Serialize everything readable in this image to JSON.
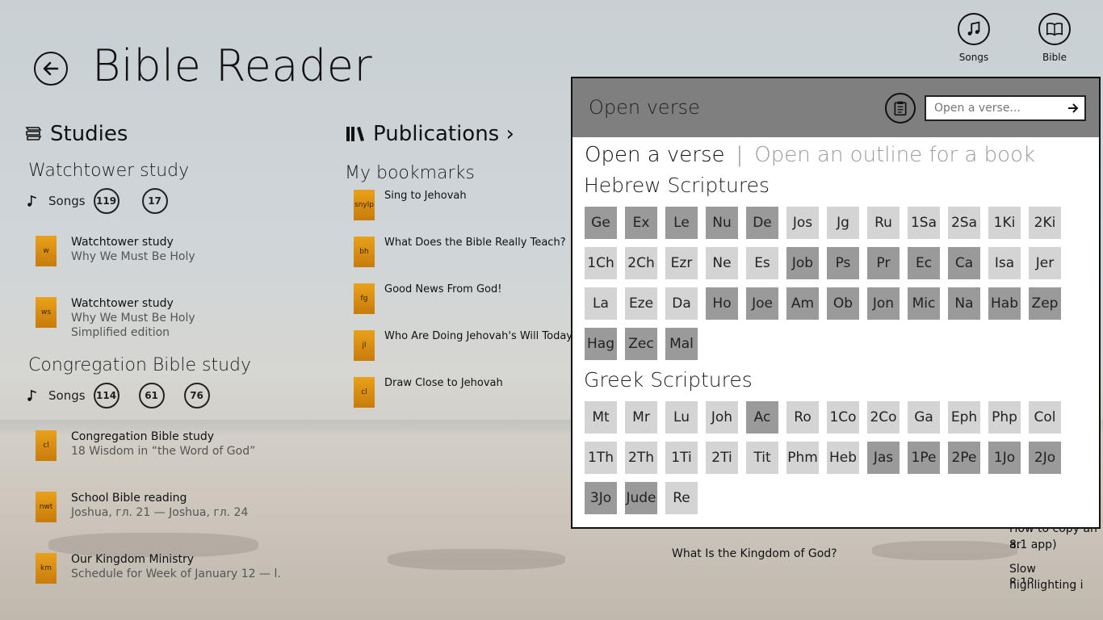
{
  "app": {
    "title": "Bible Reader"
  },
  "topbar": {
    "songs_label": "Songs",
    "bible_label": "Bible"
  },
  "studies": {
    "heading": "Studies",
    "watchtower": {
      "title": "Watchtower study",
      "songs_label": "Songs",
      "songs": [
        "119",
        "17"
      ],
      "items": [
        {
          "code": "w",
          "title": "Watchtower study",
          "subtitle": "Why We Must Be Holy",
          "extra": ""
        },
        {
          "code": "ws",
          "title": "Watchtower study",
          "subtitle": "Why We Must Be Holy",
          "extra": "Simplified edition"
        }
      ]
    },
    "congregation": {
      "title": "Congregation Bible study",
      "songs_label": "Songs",
      "songs": [
        "114",
        "61",
        "76"
      ],
      "items": [
        {
          "code": "cl",
          "title": "Congregation Bible study",
          "subtitle": "18 Wisdom in “the Word of God”"
        },
        {
          "code": "nwt",
          "title": "School Bible reading",
          "subtitle": "Joshua, гл. 21 — Joshua, гл. 24"
        },
        {
          "code": "km",
          "title": "Our Kingdom Ministry",
          "subtitle": "Schedule for Week of January 12 — l."
        }
      ]
    }
  },
  "publications": {
    "heading": "Publications ›",
    "bookmarks_title": "My bookmarks",
    "bookmarks": [
      {
        "code": "snylp",
        "title": "Sing to Jehovah"
      },
      {
        "code": "bh",
        "title": "What Does the Bible Really Teach?"
      },
      {
        "code": "fg",
        "title": "Good News From God!"
      },
      {
        "code": "jl",
        "title": "Who Are Doing Jehovah's Will Today?"
      },
      {
        "code": "cl",
        "title": "Draw Close to Jehovah"
      }
    ]
  },
  "dialog": {
    "title": "Open verse",
    "input_placeholder": "Open a verse...",
    "tab_active": "Open a verse",
    "tab_separator": "|",
    "tab_inactive": "Open an outline for a book",
    "hebrew_heading": "Hebrew Scriptures",
    "greek_heading": "Greek Scriptures",
    "hebrew_books": [
      {
        "n": "Ge",
        "s": "dark"
      },
      {
        "n": "Ex",
        "s": "dark"
      },
      {
        "n": "Le",
        "s": "dark"
      },
      {
        "n": "Nu",
        "s": "dark"
      },
      {
        "n": "De",
        "s": "dark"
      },
      {
        "n": "Jos",
        "s": "light"
      },
      {
        "n": "Jg",
        "s": "light"
      },
      {
        "n": "Ru",
        "s": "light"
      },
      {
        "n": "1Sa",
        "s": "light"
      },
      {
        "n": "2Sa",
        "s": "light"
      },
      {
        "n": "1Ki",
        "s": "light"
      },
      {
        "n": "2Ki",
        "s": "light"
      },
      {
        "n": "1Ch",
        "s": "light"
      },
      {
        "n": "2Ch",
        "s": "light"
      },
      {
        "n": "Ezr",
        "s": "light"
      },
      {
        "n": "Ne",
        "s": "light"
      },
      {
        "n": "Es",
        "s": "light"
      },
      {
        "n": "Job",
        "s": "dark"
      },
      {
        "n": "Ps",
        "s": "dark"
      },
      {
        "n": "Pr",
        "s": "dark"
      },
      {
        "n": "Ec",
        "s": "dark"
      },
      {
        "n": "Ca",
        "s": "dark"
      },
      {
        "n": "Isa",
        "s": "light"
      },
      {
        "n": "Jer",
        "s": "light"
      },
      {
        "n": "La",
        "s": "light"
      },
      {
        "n": "Eze",
        "s": "light"
      },
      {
        "n": "Da",
        "s": "light"
      },
      {
        "n": "Ho",
        "s": "dark"
      },
      {
        "n": "Joe",
        "s": "dark"
      },
      {
        "n": "Am",
        "s": "dark"
      },
      {
        "n": "Ob",
        "s": "dark"
      },
      {
        "n": "Jon",
        "s": "dark"
      },
      {
        "n": "Mic",
        "s": "dark"
      },
      {
        "n": "Na",
        "s": "dark"
      },
      {
        "n": "Hab",
        "s": "dark"
      },
      {
        "n": "Zep",
        "s": "dark"
      },
      {
        "n": "Hag",
        "s": "dark"
      },
      {
        "n": "Zec",
        "s": "dark"
      },
      {
        "n": "Mal",
        "s": "dark"
      }
    ],
    "greek_books": [
      {
        "n": "Mt",
        "s": "light"
      },
      {
        "n": "Mr",
        "s": "light"
      },
      {
        "n": "Lu",
        "s": "light"
      },
      {
        "n": "Joh",
        "s": "light"
      },
      {
        "n": "Ac",
        "s": "dark"
      },
      {
        "n": "Ro",
        "s": "light"
      },
      {
        "n": "1Co",
        "s": "light"
      },
      {
        "n": "2Co",
        "s": "light"
      },
      {
        "n": "Ga",
        "s": "light"
      },
      {
        "n": "Eph",
        "s": "light"
      },
      {
        "n": "Php",
        "s": "light"
      },
      {
        "n": "Col",
        "s": "light"
      },
      {
        "n": "1Th",
        "s": "light"
      },
      {
        "n": "2Th",
        "s": "light"
      },
      {
        "n": "1Ti",
        "s": "light"
      },
      {
        "n": "2Ti",
        "s": "light"
      },
      {
        "n": "Tit",
        "s": "light"
      },
      {
        "n": "Phm",
        "s": "light"
      },
      {
        "n": "Heb",
        "s": "light"
      },
      {
        "n": "Jas",
        "s": "dark"
      },
      {
        "n": "1Pe",
        "s": "dark"
      },
      {
        "n": "2Pe",
        "s": "dark"
      },
      {
        "n": "1Jo",
        "s": "dark"
      },
      {
        "n": "2Jo",
        "s": "dark"
      },
      {
        "n": "3Jo",
        "s": "dark"
      },
      {
        "n": "Jude",
        "s": "dark"
      },
      {
        "n": "Re",
        "s": "light"
      }
    ]
  },
  "background_items": {
    "kingdom": "What Is the Kingdom of God?",
    "right_1": "How to copy an ar",
    "right_2": "8.1 app)",
    "right_3": "Slow highlighting i",
    "right_4": "8.12"
  },
  "colors": {
    "book_light": "#d4d4d4",
    "book_dark": "#9a9a9a",
    "dialog_header": "#7f7f7f",
    "thumb": "#e09515"
  }
}
